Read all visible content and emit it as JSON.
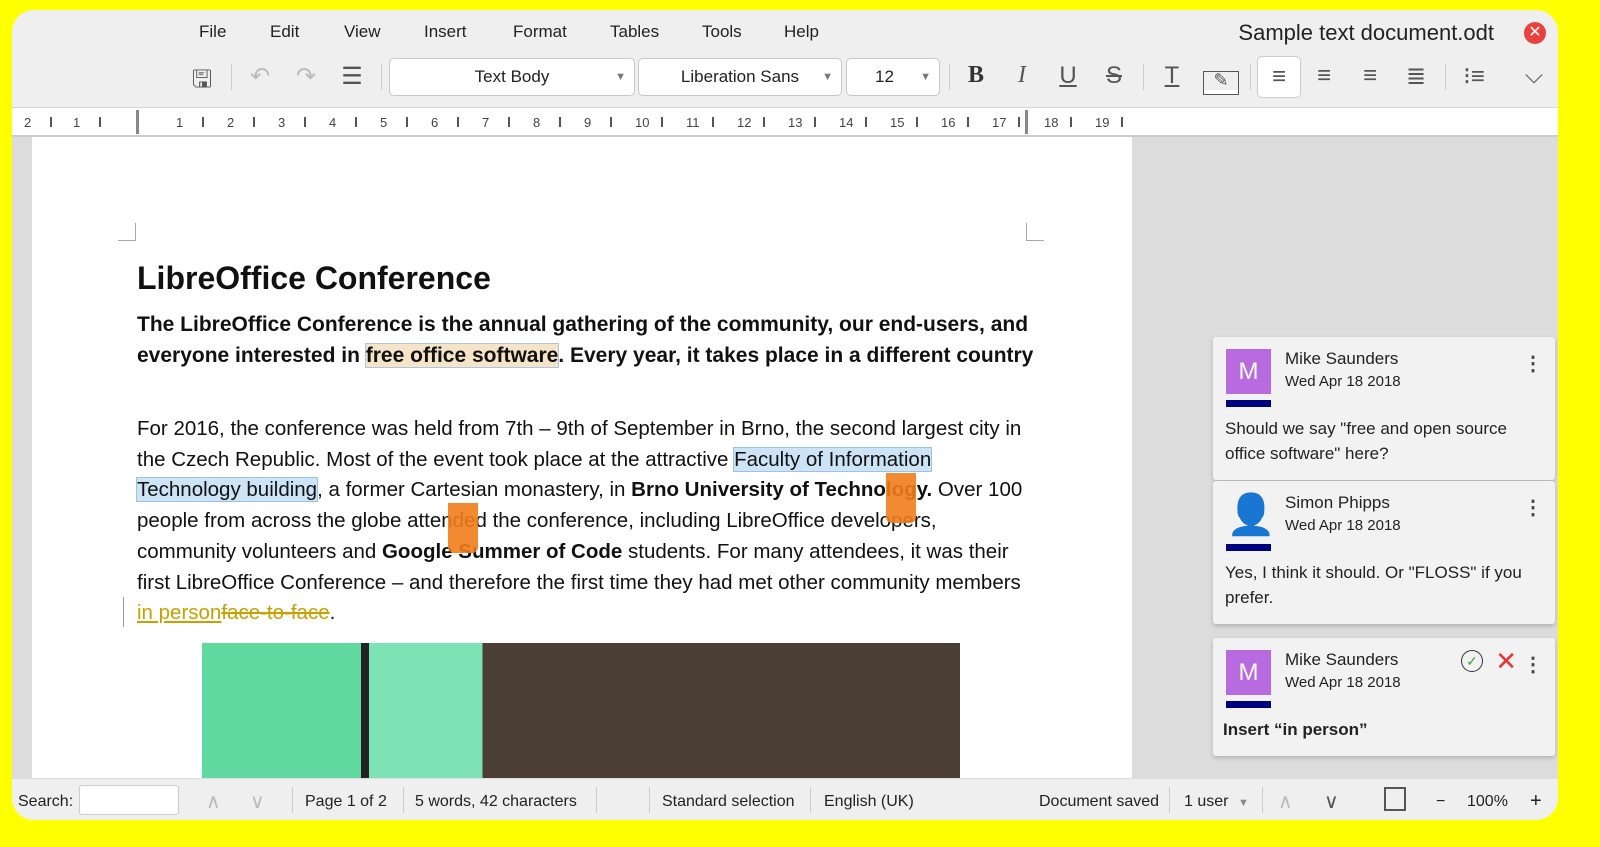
{
  "window": {
    "title": "Sample text document.odt"
  },
  "menu": [
    "File",
    "Edit",
    "View",
    "Insert",
    "Format",
    "Tables",
    "Tools",
    "Help"
  ],
  "toolbar": {
    "paragraph_style": "Text Body",
    "font_name": "Liberation Sans",
    "font_size": "12",
    "icons": [
      "save-icon",
      "undo-icon",
      "redo-icon",
      "line-spacing-icon",
      "bold-icon",
      "italic-icon",
      "underline-icon",
      "strikethrough-icon",
      "clear-formatting-icon",
      "highlight-icon",
      "align-left-icon",
      "align-center-icon",
      "align-right-icon",
      "justify-icon",
      "list-icon",
      "expand-icon"
    ]
  },
  "ruler": [
    "2",
    "1",
    "1",
    "2",
    "3",
    "4",
    "5",
    "6",
    "7",
    "8",
    "9",
    "10",
    "11",
    "12",
    "13",
    "14",
    "15",
    "16",
    "17",
    "18",
    "19"
  ],
  "document": {
    "heading": "LibreOffice Conference",
    "p1": {
      "a": "The LibreOffice Conference is the annual gathering of the community, our end-users, and everyone interested in ",
      "hl": "free office software",
      "b": ". Every year, it takes place in a different country"
    },
    "p2": {
      "a": "For 2016, the conference was held from 7th – 9th of September in Brno, the second largest city in the Czech Republic. Most of the event took place at the attractive ",
      "sel": "Faculty of Information Technology building",
      "b": ", a former Cartesian monastery, in ",
      "bold1": "Brno University of Technology.",
      "c": " Over 100 people from across the globe attended the conference, including LibreOffice developers, community volunteers and ",
      "bold2": "Google Summer of Code",
      "d": " students. For many attendees, it was their first LibreOffice Conference – and therefore the first time they had met other community members ",
      "ins": "in person",
      "del": "face-to-face",
      "e": "."
    }
  },
  "comments": [
    {
      "author": "Mike Saunders",
      "initial": "M",
      "date": "Wed Apr 18 2018",
      "text": "Should we say \"free and open source office software\" here?"
    },
    {
      "author": "Simon Phipps",
      "initial": "",
      "date": "Wed Apr 18 2018",
      "text": "Yes, I think it should. Or \"FLOSS\" if you prefer."
    },
    {
      "author": "Mike Saunders",
      "initial": "M",
      "date": "Wed Apr 18 2018",
      "text": "Insert “in person”"
    }
  ],
  "status": {
    "search_label": "Search:",
    "search_value": "",
    "page": "Page 1 of 2",
    "words": "5 words, 42 characters",
    "selection": "Standard selection",
    "language": "English (UK)",
    "saved": "Document saved",
    "users": "1 user",
    "zoom": "100%",
    "zoom_out": "−",
    "zoom_in": "+"
  },
  "colors": {
    "frame": "#ffff00",
    "avatar": "#b86bdf",
    "author_bar": "#000080",
    "tracked_change": "#c8a000"
  }
}
